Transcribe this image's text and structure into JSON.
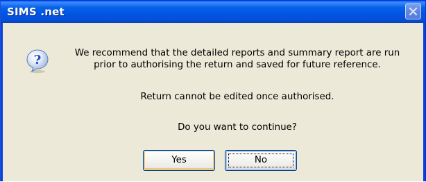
{
  "window": {
    "title": "SIMS .net"
  },
  "message": {
    "line1": "We recommend that the detailed reports and summary report are run",
    "line2": "prior to authorising the return and saved for future reference.",
    "line3": "Return cannot be edited once authorised.",
    "line4": "Do you want to continue?"
  },
  "buttons": {
    "yes_label": "Yes",
    "no_label": "No"
  },
  "icons": {
    "dialog_icon": "question-icon",
    "close": "close-icon"
  },
  "colors": {
    "titlebar": "#0054e3",
    "dialog_background": "#ece9d8",
    "question_icon": "#2f6bd9"
  }
}
